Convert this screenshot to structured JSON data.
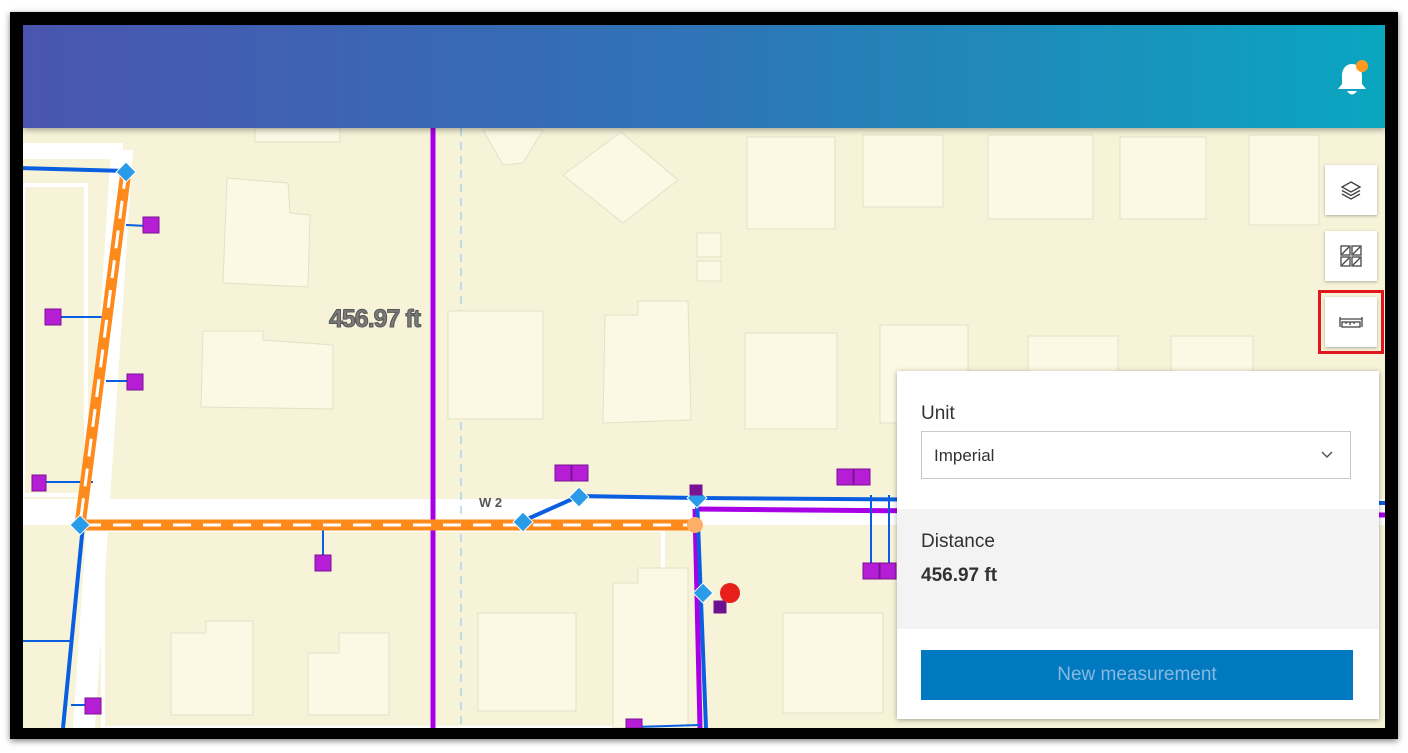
{
  "header": {
    "bell_icon": "bell-icon",
    "notification_color": "#ff9a1f"
  },
  "map": {
    "measurement_label": "456.97 ft",
    "street_label": "W 2"
  },
  "toolbar": {
    "layers_icon": "layers-icon",
    "basemap_icon": "basemap-gallery-icon",
    "measure_icon": "ruler-icon"
  },
  "measure_panel": {
    "unit_label": "Unit",
    "unit_value": "Imperial",
    "distance_label": "Distance",
    "distance_value": "456.97 ft",
    "new_button_label": "New measurement"
  },
  "colors": {
    "accent": "#0079c1",
    "active_outline": "#e0171d",
    "measure_line": "#ff8a1c",
    "electric_line": "#a800e6",
    "water_line": "#0a5ee0"
  }
}
